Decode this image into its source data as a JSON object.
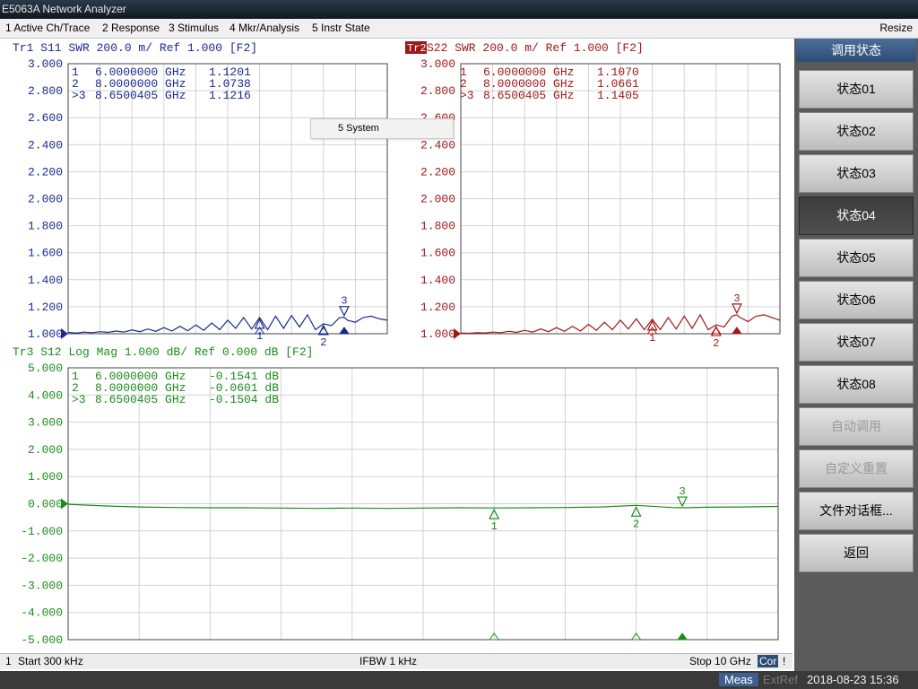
{
  "app": {
    "title": "E5063A Network Analyzer"
  },
  "menu": {
    "items": [
      "1 Active Ch/Trace",
      "2 Response",
      "3 Stimulus",
      "4 Mkr/Analysis",
      "5 Instr State"
    ],
    "resize": "Resize",
    "dropdown_item": "5 System"
  },
  "softkeys": {
    "title": "调用状态",
    "items": [
      {
        "label": "状态01",
        "state": "normal"
      },
      {
        "label": "状态02",
        "state": "normal"
      },
      {
        "label": "状态03",
        "state": "normal"
      },
      {
        "label": "状态04",
        "state": "active"
      },
      {
        "label": "状态05",
        "state": "normal"
      },
      {
        "label": "状态06",
        "state": "normal"
      },
      {
        "label": "状态07",
        "state": "normal"
      },
      {
        "label": "状态08",
        "state": "normal"
      },
      {
        "label": "自动调用",
        "state": "disabled"
      },
      {
        "label": "自定义重置",
        "state": "disabled"
      },
      {
        "label": "文件对话框...",
        "state": "normal"
      },
      {
        "label": "返回",
        "state": "normal"
      }
    ]
  },
  "status": {
    "channel": "1",
    "start": "Start 300 kHz",
    "ifbw": "IFBW 1 kHz",
    "stop": "Stop 10 GHz",
    "cor": "Cor",
    "bang": "!"
  },
  "bottom": {
    "meas": "Meas",
    "extref": "ExtRef",
    "datetime": "2018-08-23 15:36"
  },
  "chart_data": [
    {
      "type": "line",
      "trace_id": "Tr1",
      "header": "Tr1  S11  SWR 200.0 m/  Ref 1.000   [F2]",
      "color": "#1a2a8c",
      "x_range_ghz": [
        0.0003,
        10
      ],
      "ylim": [
        1.0,
        3.0
      ],
      "y_ticks": [
        "3.000",
        "2.800",
        "2.600",
        "2.400",
        "2.200",
        "2.000",
        "1.800",
        "1.600",
        "1.400",
        "1.200",
        "1.000"
      ],
      "markers": [
        {
          "label": "1",
          "freq": "6.0000000 GHz",
          "value": "1.1201",
          "x": 6.0,
          "y": 1.1201,
          "active": false
        },
        {
          "label": "2",
          "freq": "8.0000000 GHz",
          "value": "1.0738",
          "x": 8.0,
          "y": 1.0738,
          "active": false
        },
        {
          "label": ">3",
          "freq": "8.6500405 GHz",
          "value": "1.1216",
          "x": 8.65,
          "y": 1.1216,
          "active": true
        }
      ],
      "series": {
        "x": [
          0.0003,
          0.25,
          0.5,
          0.75,
          1,
          1.25,
          1.5,
          1.75,
          2,
          2.25,
          2.5,
          2.75,
          3,
          3.25,
          3.5,
          3.75,
          4,
          4.25,
          4.5,
          4.75,
          5,
          5.25,
          5.5,
          5.75,
          6,
          6.25,
          6.5,
          6.75,
          7,
          7.25,
          7.5,
          7.75,
          8,
          8.25,
          8.5,
          8.65,
          8.75,
          9,
          9.25,
          9.5,
          9.75,
          10
        ],
        "y": [
          1.01,
          1.005,
          1.012,
          1.008,
          1.015,
          1.01,
          1.02,
          1.012,
          1.028,
          1.015,
          1.035,
          1.018,
          1.045,
          1.02,
          1.055,
          1.022,
          1.065,
          1.025,
          1.08,
          1.03,
          1.1,
          1.04,
          1.12,
          1.035,
          1.12,
          1.03,
          1.13,
          1.04,
          1.135,
          1.05,
          1.14,
          1.03,
          1.074,
          1.06,
          1.118,
          1.122,
          1.1,
          1.085,
          1.12,
          1.13,
          1.11,
          1.1
        ]
      }
    },
    {
      "type": "line",
      "trace_id": "Tr2",
      "header": "S22  SWR 200.0 m/  Ref 1.000   [F2]",
      "color": "#a01818",
      "x_range_ghz": [
        0.0003,
        10
      ],
      "ylim": [
        1.0,
        3.0
      ],
      "y_ticks": [
        "3.000",
        "2.800",
        "2.600",
        "2.400",
        "2.200",
        "2.000",
        "1.800",
        "1.600",
        "1.400",
        "1.200",
        "1.000"
      ],
      "markers": [
        {
          "label": "1",
          "freq": "6.0000000 GHz",
          "value": "1.1070",
          "x": 6.0,
          "y": 1.107,
          "active": false
        },
        {
          "label": "2",
          "freq": "8.0000000 GHz",
          "value": "1.0661",
          "x": 8.0,
          "y": 1.0661,
          "active": false
        },
        {
          "label": ">3",
          "freq": "8.6500405 GHz",
          "value": "1.1405",
          "x": 8.65,
          "y": 1.1405,
          "active": true
        }
      ],
      "series": {
        "x": [
          0.0003,
          0.25,
          0.5,
          0.75,
          1,
          1.25,
          1.5,
          1.75,
          2,
          2.25,
          2.5,
          2.75,
          3,
          3.25,
          3.5,
          3.75,
          4,
          4.25,
          4.5,
          4.75,
          5,
          5.25,
          5.5,
          5.75,
          6,
          6.25,
          6.5,
          6.75,
          7,
          7.25,
          7.5,
          7.75,
          8,
          8.25,
          8.5,
          8.65,
          8.75,
          9,
          9.25,
          9.5,
          9.75,
          10
        ],
        "y": [
          1.005,
          1.003,
          1.008,
          1.006,
          1.012,
          1.008,
          1.018,
          1.01,
          1.025,
          1.012,
          1.035,
          1.015,
          1.045,
          1.018,
          1.055,
          1.02,
          1.07,
          1.025,
          1.085,
          1.03,
          1.1,
          1.035,
          1.11,
          1.03,
          1.107,
          1.03,
          1.12,
          1.035,
          1.13,
          1.04,
          1.14,
          1.03,
          1.066,
          1.05,
          1.13,
          1.14,
          1.12,
          1.09,
          1.13,
          1.14,
          1.12,
          1.1
        ]
      }
    },
    {
      "type": "line",
      "trace_id": "Tr3",
      "header": "Tr3  S12  Log Mag 1.000 dB/  Ref 0.000 dB  [F2]",
      "color": "#1a8c1a",
      "x_range_ghz": [
        0.0003,
        10
      ],
      "ylim": [
        -5.0,
        5.0
      ],
      "y_ticks": [
        "5.000",
        "4.000",
        "3.000",
        "2.000",
        "1.000",
        "0.000",
        "-1.000",
        "-2.000",
        "-3.000",
        "-4.000",
        "-5.000"
      ],
      "markers": [
        {
          "label": "1",
          "freq": "6.0000000 GHz",
          "value": "-0.1541 dB",
          "x": 6.0,
          "y": -0.1541,
          "active": false
        },
        {
          "label": "2",
          "freq": "8.0000000 GHz",
          "value": "-0.0601 dB",
          "x": 8.0,
          "y": -0.0601,
          "active": false
        },
        {
          "label": ">3",
          "freq": "8.6500405 GHz",
          "value": "-0.1504 dB",
          "x": 8.65,
          "y": -0.1504,
          "active": true
        }
      ],
      "series": {
        "x": [
          0.0003,
          0.5,
          1,
          1.5,
          2,
          2.5,
          3,
          3.5,
          4,
          4.5,
          5,
          5.5,
          6,
          6.5,
          7,
          7.5,
          8,
          8.5,
          8.65,
          9,
          9.5,
          10
        ],
        "y": [
          -0.02,
          -0.08,
          -0.12,
          -0.14,
          -0.15,
          -0.15,
          -0.16,
          -0.17,
          -0.16,
          -0.17,
          -0.16,
          -0.15,
          -0.154,
          -0.15,
          -0.14,
          -0.12,
          -0.06,
          -0.14,
          -0.15,
          -0.13,
          -0.12,
          -0.1
        ]
      }
    }
  ]
}
